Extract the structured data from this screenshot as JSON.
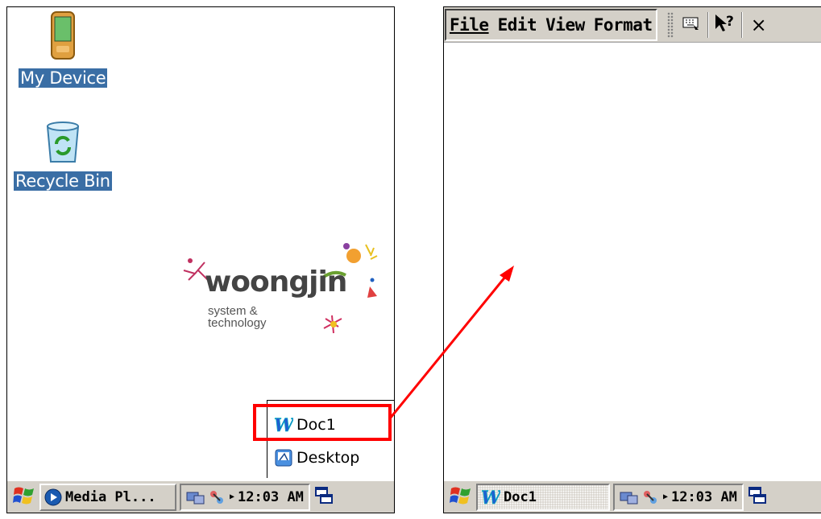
{
  "left": {
    "desktop_icons": [
      {
        "label": "My Device",
        "icon": "pda-icon"
      },
      {
        "label": "Recycle Bin",
        "icon": "recycle-bin-icon"
      }
    ],
    "logo": {
      "word": "woongjin",
      "sub1": "system &",
      "sub2": "technology"
    },
    "popup": {
      "items": [
        {
          "label": "Doc1",
          "icon": "word-icon"
        },
        {
          "label": "Desktop",
          "icon": "desktop-icon"
        }
      ]
    },
    "taskbar": {
      "task_label": "Media Pl...",
      "time": "12:03 AM"
    }
  },
  "right": {
    "menu": [
      "File",
      "Edit",
      "View",
      "Format"
    ],
    "close_label": "×",
    "taskbar": {
      "task_label": "Doc1",
      "time": "12:03 AM"
    }
  },
  "colors": {
    "highlight": "#ff0000",
    "selection": "#3a6ea5",
    "taskbar": "#d4d0c8"
  }
}
